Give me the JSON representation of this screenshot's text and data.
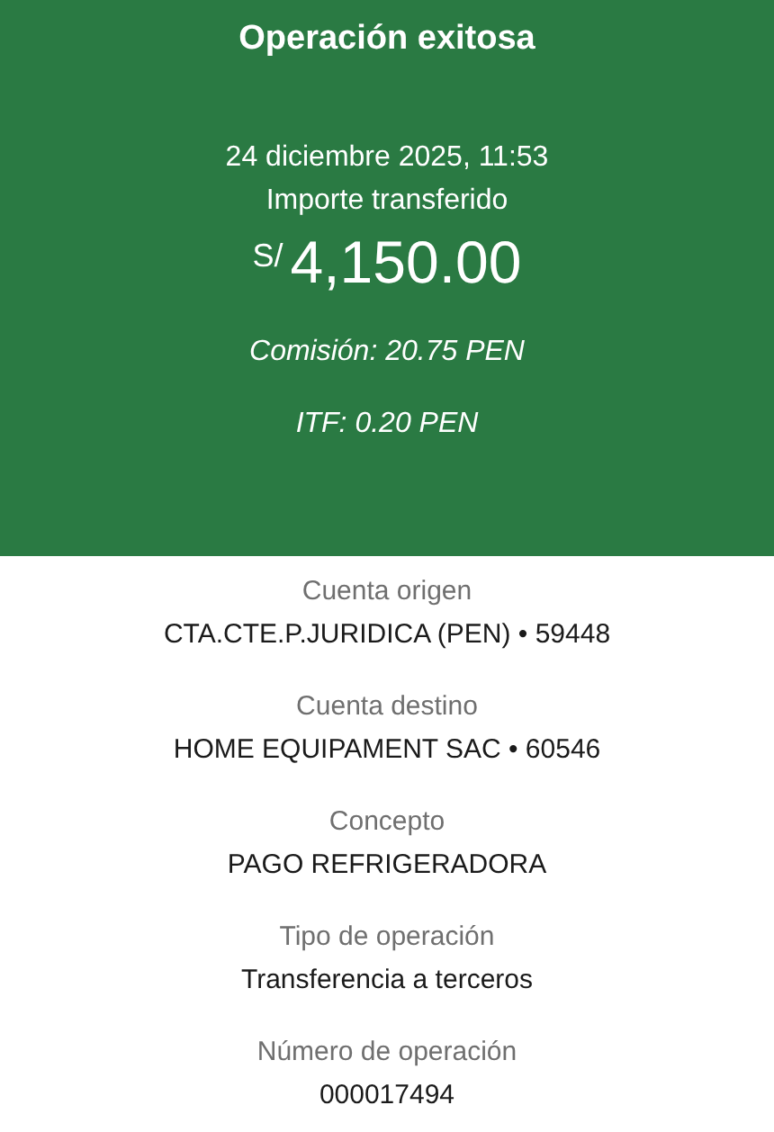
{
  "header": {
    "title": "Operación exitosa",
    "date": "24 diciembre 2025, 11:53",
    "amount_label": "Importe transferido",
    "currency": "S/",
    "amount": "4,150.00",
    "fees": [
      "Comisión: 20.75 PEN",
      "ITF: 0.20 PEN"
    ]
  },
  "details": [
    {
      "label": "Cuenta origen",
      "value": "CTA.CTE.P.JURIDICA (PEN) • 59448"
    },
    {
      "label": "Cuenta destino",
      "value": "HOME EQUIPAMENT SAC • 60546"
    },
    {
      "label": "Concepto",
      "value": "PAGO REFRIGERADORA"
    },
    {
      "label": "Tipo de operación",
      "value": "Transferencia a terceros"
    },
    {
      "label": "Número de operación",
      "value": "000017494"
    }
  ]
}
